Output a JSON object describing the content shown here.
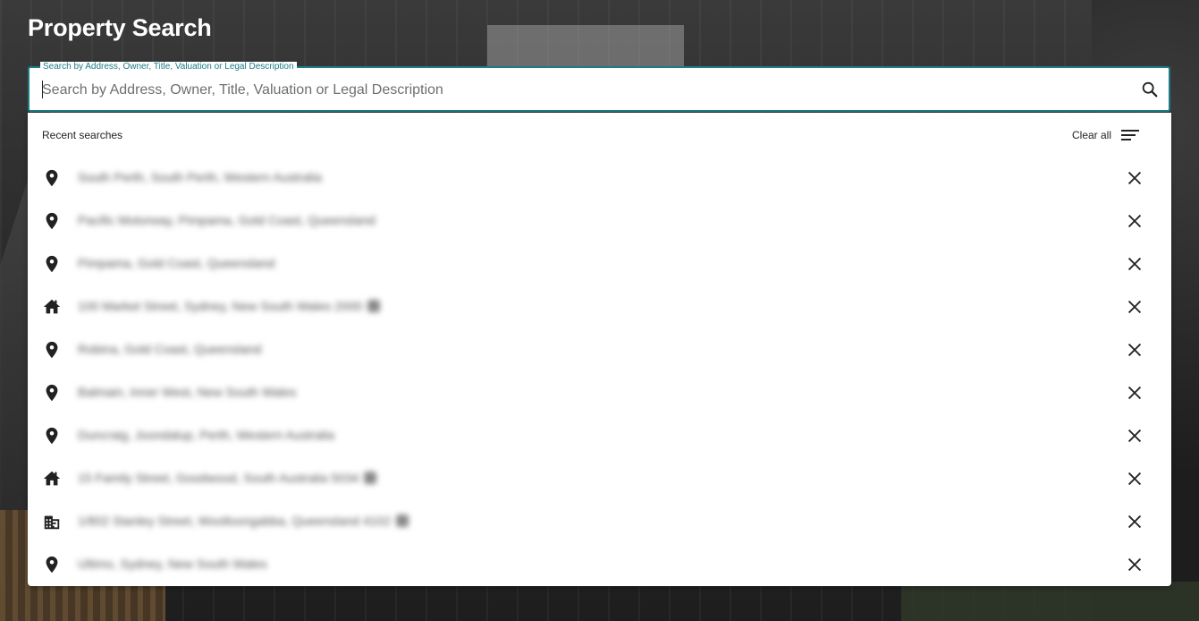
{
  "page": {
    "title": "Property Search"
  },
  "search": {
    "label": "Search by Address, Owner, Title, Valuation or Legal Description",
    "placeholder": "Search by Address, Owner, Title, Valuation or Legal Description",
    "value": ""
  },
  "recent": {
    "header_label": "Recent searches",
    "clear_all_label": "Clear all",
    "items": [
      {
        "icon": "location-pin-icon",
        "text": "South Perth, South Perth, Western Australia",
        "badge": false
      },
      {
        "icon": "location-pin-icon",
        "text": "Pacific Motorway, Pimpama, Gold Coast, Queensland",
        "badge": false
      },
      {
        "icon": "location-pin-icon",
        "text": "Pimpama, Gold Coast, Queensland",
        "badge": false
      },
      {
        "icon": "house-icon",
        "text": "100 Market Street, Sydney, New South Wales 2000",
        "badge": true
      },
      {
        "icon": "location-pin-icon",
        "text": "Robina, Gold Coast, Queensland",
        "badge": false
      },
      {
        "icon": "location-pin-icon",
        "text": "Balmain, Inner West, New South Wales",
        "badge": false
      },
      {
        "icon": "location-pin-icon",
        "text": "Duncraig, Joondalup, Perth, Western Australia",
        "badge": false
      },
      {
        "icon": "house-icon",
        "text": "15 Family Street, Goodwood, South Australia 5034",
        "badge": true
      },
      {
        "icon": "building-icon",
        "text": "1/802 Stanley Street, Woolloongabba, Queensland 4102",
        "badge": true
      },
      {
        "icon": "location-pin-icon",
        "text": "Ultimo, Sydney, New South Wales",
        "badge": false
      }
    ]
  },
  "colors": {
    "accent": "#1c7c87",
    "icon": "#222222"
  }
}
